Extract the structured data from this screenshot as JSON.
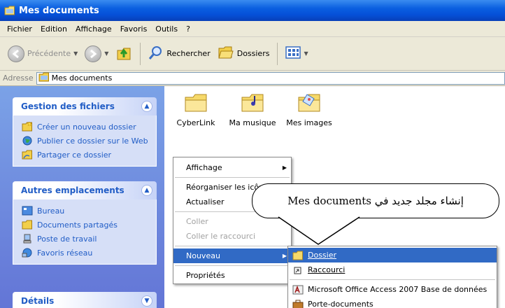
{
  "window": {
    "title": "Mes documents"
  },
  "menu": [
    "Fichier",
    "Edition",
    "Affichage",
    "Favoris",
    "Outils",
    "?"
  ],
  "toolbar": {
    "back": "Précédente",
    "search": "Rechercher",
    "folders": "Dossiers"
  },
  "address": {
    "label": "Adresse",
    "value": "Mes documents"
  },
  "panels": {
    "file_tasks": {
      "title": "Gestion des fichiers",
      "items": [
        "Créer un nouveau dossier",
        "Publier ce dossier sur le Web",
        "Partager ce dossier"
      ]
    },
    "other_places": {
      "title": "Autres emplacements",
      "items": [
        "Bureau",
        "Documents partagés",
        "Poste de travail",
        "Favoris réseau"
      ]
    },
    "details": {
      "title": "Détails"
    }
  },
  "folders": [
    "CyberLink",
    "Ma musique",
    "Mes images"
  ],
  "context_menu": {
    "view": "Affichage",
    "arrange": "Réorganiser les icônes",
    "refresh": "Actualiser",
    "paste": "Coller",
    "paste_shortcut": "Coller le raccourci",
    "new": "Nouveau",
    "properties": "Propriétés"
  },
  "new_submenu": {
    "folder": "Dossier",
    "shortcut": "Raccourci",
    "access": "Microsoft Office Access 2007 Base de données",
    "briefcase": "Porte-documents"
  },
  "callout": {
    "text": "إنشاء مجلد جديد في  Mes documents"
  },
  "colors": {
    "title_blue": "#0550d8",
    "panel_blue": "#215dc6",
    "highlight": "#316ac5"
  }
}
